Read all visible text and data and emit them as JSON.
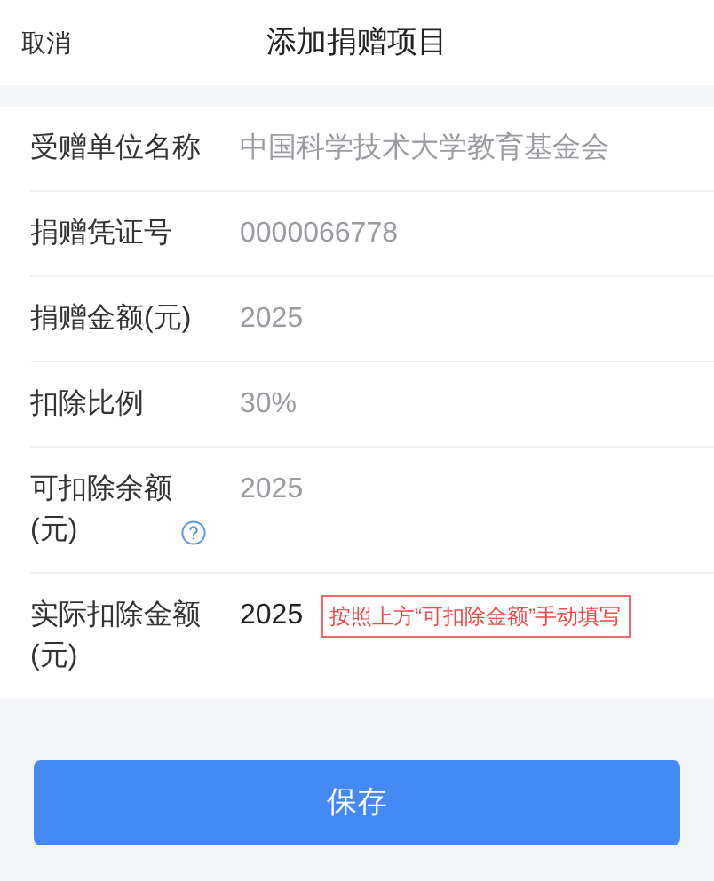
{
  "header": {
    "cancel": "取消",
    "title": "添加捐赠项目"
  },
  "fields": [
    {
      "label": "受赠单位名称",
      "value": "中国科学技术大学教育基金会",
      "editable": false
    },
    {
      "label": "捐赠凭证号",
      "value": "0000066778",
      "editable": false
    },
    {
      "label": "捐赠金额(元)",
      "value": "2025",
      "editable": false
    },
    {
      "label": "扣除比例",
      "value": "30%",
      "editable": false
    },
    {
      "label": "可扣除余额(元)",
      "value": "2025",
      "editable": false,
      "help": true
    },
    {
      "label": "实际扣除金额(元)",
      "value": "2025",
      "editable": true,
      "note": "按照上方“可扣除金额”手动填写"
    }
  ],
  "save_button": "保存"
}
